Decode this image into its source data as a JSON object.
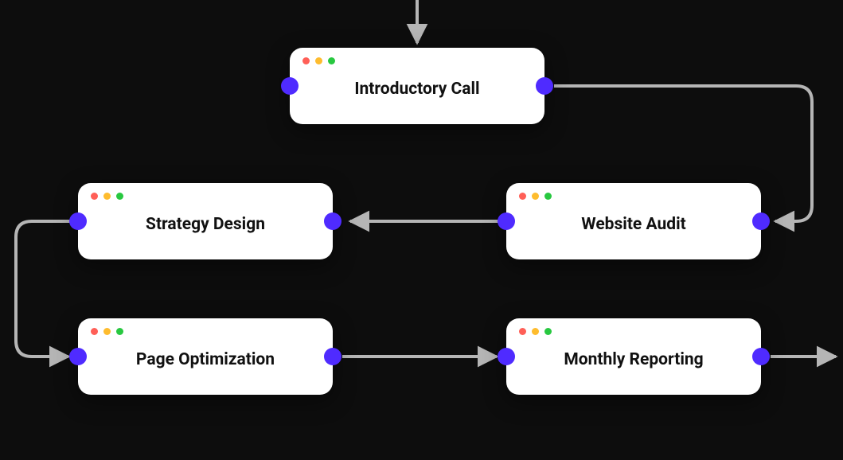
{
  "colors": {
    "background": "#0d0d0d",
    "node_bg": "#ffffff",
    "port": "#4f2bff",
    "connector": "#b5b5b5",
    "traffic_red": "#ff5f57",
    "traffic_yellow": "#febc2e",
    "traffic_green": "#28c840"
  },
  "nodes": {
    "intro": {
      "title": "Introductory Call"
    },
    "audit": {
      "title": "Website Audit"
    },
    "strategy": {
      "title": "Strategy Design"
    },
    "page_opt": {
      "title": "Page Optimization"
    },
    "report": {
      "title": "Monthly Reporting"
    }
  },
  "flow_order": [
    "Introductory Call",
    "Website Audit",
    "Strategy Design",
    "Page Optimization",
    "Monthly Reporting"
  ]
}
